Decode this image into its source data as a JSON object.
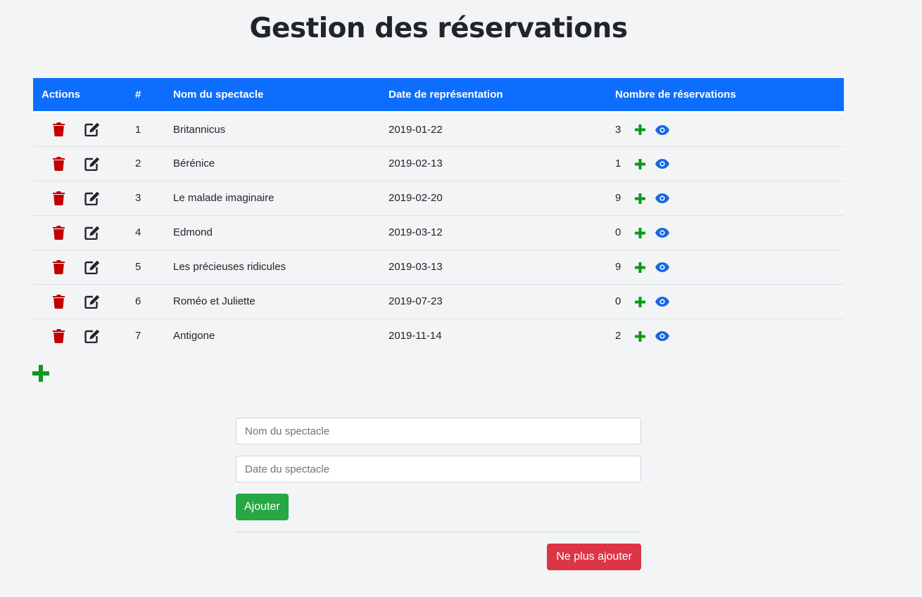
{
  "page": {
    "title": "Gestion des réservations"
  },
  "table": {
    "headers": {
      "actions": "Actions",
      "num": "#",
      "name": "Nom du spectacle",
      "date": "Date de représentation",
      "count": "Nombre de réservations"
    },
    "rows": [
      {
        "num": "1",
        "name": "Britannicus",
        "date": "2019-01-22",
        "count": "3"
      },
      {
        "num": "2",
        "name": "Bérénice",
        "date": "2019-02-13",
        "count": "1"
      },
      {
        "num": "3",
        "name": "Le malade imaginaire",
        "date": "2019-02-20",
        "count": "9"
      },
      {
        "num": "4",
        "name": "Edmond",
        "date": "2019-03-12",
        "count": "0"
      },
      {
        "num": "5",
        "name": "Les précieuses ridicules",
        "date": "2019-03-13",
        "count": "9"
      },
      {
        "num": "6",
        "name": "Roméo et Juliette",
        "date": "2019-07-23",
        "count": "0"
      },
      {
        "num": "7",
        "name": "Antigone",
        "date": "2019-11-14",
        "count": "2"
      }
    ]
  },
  "form": {
    "name_placeholder": "Nom du spectacle",
    "date_placeholder": "Date du spectacle",
    "add_label": "Ajouter",
    "stop_label": "Ne plus ajouter"
  },
  "icons": {
    "delete": "trash-icon",
    "edit": "edit-icon",
    "add": "plus-icon",
    "view": "eye-icon"
  },
  "colors": {
    "header_bg": "#0d6efd",
    "delete": "#c00000",
    "add": "#0a9a1a",
    "view": "#0d6efd",
    "add_button": "#28a745",
    "stop_button": "#dc3545"
  }
}
